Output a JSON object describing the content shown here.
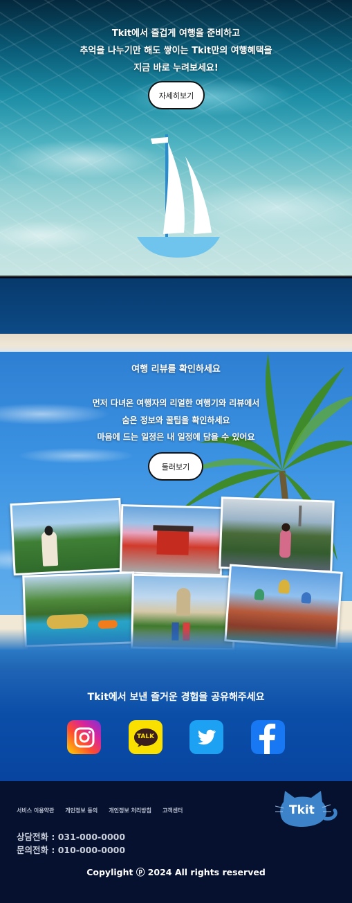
{
  "hero": {
    "lines": [
      "Tkit에서 즐겁게 여행을 준비하고",
      "추억을 나누기만 해도 쌓이는 Tkit만의 여행혜택을",
      "지금 바로 누려보세요!"
    ],
    "button_label": "자세히보기"
  },
  "review": {
    "title": "여행 리뷰를 확인하세요",
    "lines": [
      "먼저 다녀온 여행자의 리얼한 여행기와 리뷰에서",
      "숨은 정보와 꿀팁을 확인하세요",
      "마음에 드는 일정은 내 일정에 담을 수 있어요"
    ],
    "button_label": "둘러보기"
  },
  "share": {
    "title": "Tkit에서 보낸 즐거운 경험을 공유해주세요",
    "kakao_label": "TALK"
  },
  "footer": {
    "links": [
      "서비스 이용약관",
      "개인정보 동의",
      "개인정보 처리방침",
      "고객센터"
    ],
    "phone_support": "상담전화 : 031-000-0000",
    "phone_inquiry": "문의전화 : 010-000-0000",
    "copyright": "Copylight ⓟ 2024 All rights reserved",
    "logo_text": "Tkit"
  },
  "colors": {
    "footer_bg": "#06112f",
    "share_bg": "#0a4ea8",
    "logo_blue": "#3d83c9"
  }
}
